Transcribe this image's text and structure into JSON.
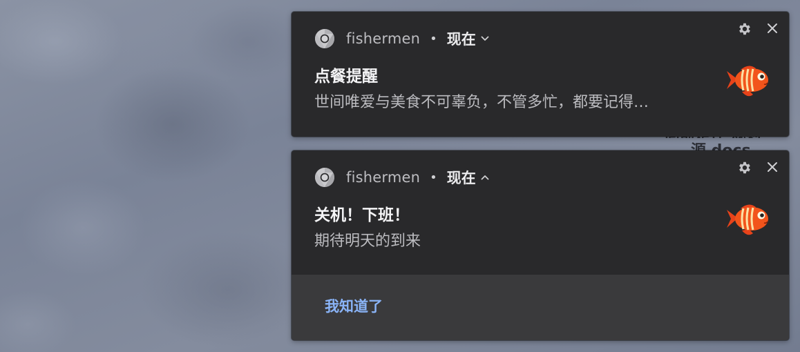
{
  "background": {
    "partial_text_line_1": "向前是存 规则",
    "partial_text_line_2": "源 docs"
  },
  "notifications": [
    {
      "app_name": "fishermen",
      "separator": "•",
      "time": "现在",
      "expanded": false,
      "title": "点餐提醒",
      "body": "世间唯爱与美食不可辜负，不管多忙，都要记得…",
      "icon": "chrome-icon",
      "image": "fish-icon"
    },
    {
      "app_name": "fishermen",
      "separator": "•",
      "time": "现在",
      "expanded": true,
      "title": "关机！下班！",
      "body": "期待明天的到来",
      "icon": "chrome-icon",
      "image": "fish-icon",
      "action_label": "我知道了"
    }
  ],
  "colors": {
    "card_bg": "#29292b",
    "action_bar_bg": "#3a3a3c",
    "action_text": "#8ab4f8",
    "fish_body": "#f2541b",
    "fish_stripe": "#fbe1a5"
  }
}
